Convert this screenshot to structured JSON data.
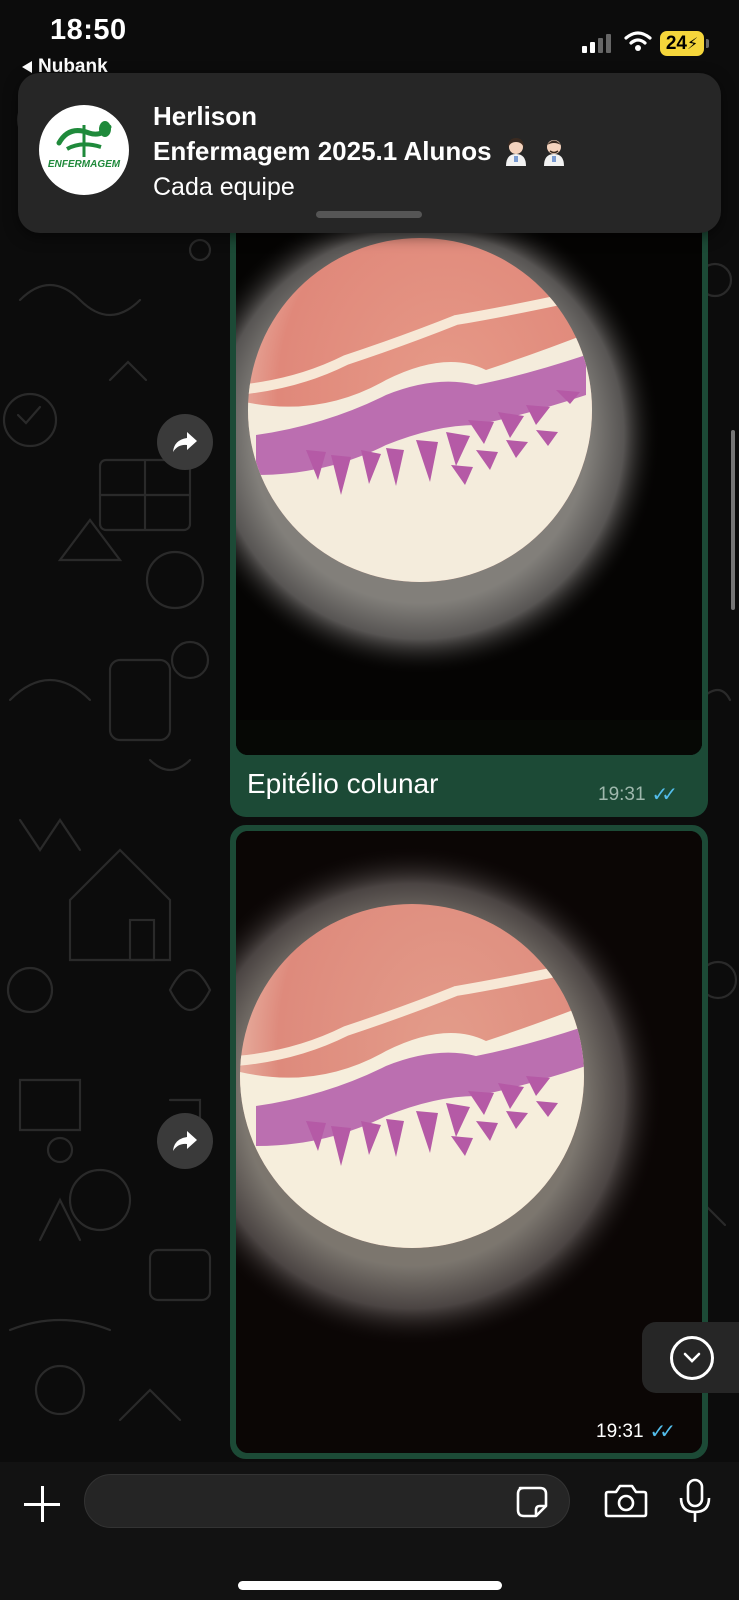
{
  "status_bar": {
    "time": "18:50",
    "back_app": "Nubank",
    "battery": "24",
    "icons": [
      "signal-icon",
      "wifi-icon",
      "battery-charging-icon"
    ]
  },
  "notification": {
    "sender": "Herlison",
    "group": "Enfermagem 2025.1 Alunos",
    "message": "Cada equipe",
    "avatar_text": "ENFERMAGEM",
    "emojis": [
      "woman-health-worker-emoji",
      "man-health-worker-emoji"
    ]
  },
  "messages": [
    {
      "type": "image",
      "caption": "Epitélio colunar",
      "time": "19:31",
      "status": "read"
    },
    {
      "type": "image",
      "caption": "",
      "time": "19:31",
      "status": "read"
    }
  ],
  "colors": {
    "bubble_outgoing": "#1c4a36",
    "read_ticks": "#53bdeb",
    "battery": "#f5d63b",
    "logo_green": "#1f8a3b"
  },
  "input_bar": {
    "value": "",
    "icons": [
      "plus-icon",
      "sticker-icon",
      "camera-icon",
      "microphone-icon"
    ]
  }
}
